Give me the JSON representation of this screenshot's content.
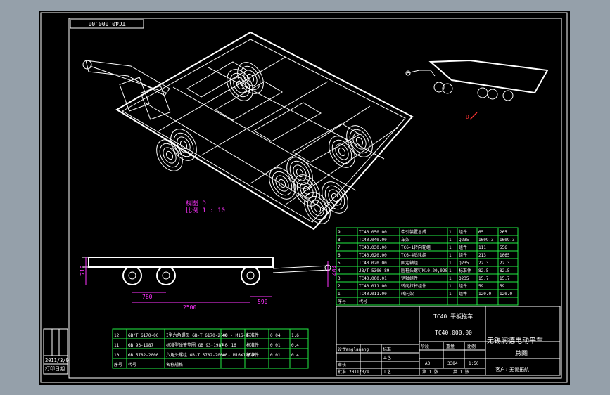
{
  "drawing_number_rotated": "TC40.000.00",
  "iso_view_label": "视图 D",
  "iso_scale_label": "比例 1 : 10",
  "small_view_label": "D",
  "dimensions": {
    "height_left": "710",
    "height_right": "404",
    "dim_a": "780",
    "dim_b": "2500",
    "dim_c": "590"
  },
  "bom_upper": [
    [
      "9",
      "TC40.050.00",
      "牵引装置总成",
      "1",
      "组件",
      "65",
      "265"
    ],
    [
      "8",
      "TC40.040.00",
      "车架",
      "1",
      "Q235",
      "1609.3",
      "1609.3"
    ],
    [
      "7",
      "TC40.030.00",
      "TC6-1转向轮组",
      "1",
      "组件",
      "111",
      "556"
    ],
    [
      "6",
      "TC40.020.00",
      "TC6-4后轮组",
      "1",
      "组件",
      "213",
      "1065"
    ],
    [
      "5",
      "TC40.020.00",
      "固定轴组",
      "1",
      "Q235",
      "22.3",
      "22.3"
    ],
    [
      "4",
      "JB/T 5306-89",
      "圆柱头螺钉M10,20,020",
      "1",
      "标准件",
      "82.5",
      "82.5"
    ],
    [
      "3",
      "TC40.000.01",
      "销轴组件",
      "1",
      "Q235",
      "15.7",
      "15.7"
    ],
    [
      "2",
      "TC40.011.00",
      "转向拉杆组件",
      "1",
      "组件",
      "59",
      "59"
    ],
    [
      "1",
      "TC40.011.00",
      "转向架",
      "1",
      "组件",
      "120.0",
      "120.0"
    ]
  ],
  "bom_upper_header": [
    "序号",
    "代号",
    "",
    "",
    "",
    "",
    ""
  ],
  "bom_lower": [
    [
      "12",
      "GB/T 6170-00",
      "I型六角螺母 GB-T 6170-2000 - M16-8",
      "40",
      "标准件",
      "0.04",
      "1.6"
    ],
    [
      "11",
      "GB 93-1987",
      "标准型弹簧垫圈 GB 93-1987 - 16",
      "40",
      "标准件",
      "0.01",
      "0.4"
    ],
    [
      "10",
      "GB 5782-2000",
      "六角头螺栓 GB-T 5782-2000 - M16X110-8",
      "40",
      "标准件",
      "0.01",
      "0.4"
    ]
  ],
  "bom_lower_header": [
    "序号",
    "代号",
    "名称规格",
    "",
    "",
    "",
    ""
  ],
  "title_block": {
    "product_name": "TC40 平板拖车",
    "drawing_code": "TC40.000.00",
    "company": "无锡润德电动平车",
    "drawing_title": "总图",
    "customer_label": "客户:",
    "customer": "无锡拓航",
    "designer_label": "设计",
    "designer": "Yanglanang",
    "standard_label": "标准",
    "craft_label": "工艺",
    "review_label": "审核",
    "approve_label": "批准",
    "date": "2011/3/9",
    "stage_label": "阶段",
    "weight_label": "重量",
    "scale_label": "比例",
    "stage": "A3",
    "weight": "3384",
    "scale": "1:50",
    "sheet_label": "第 1 张",
    "total_label": "共 1 张",
    "designer_cn": "设计",
    "process": "工艺"
  },
  "side_block": {
    "date": "2011/3/9",
    "print_date_label": "打印日期"
  }
}
